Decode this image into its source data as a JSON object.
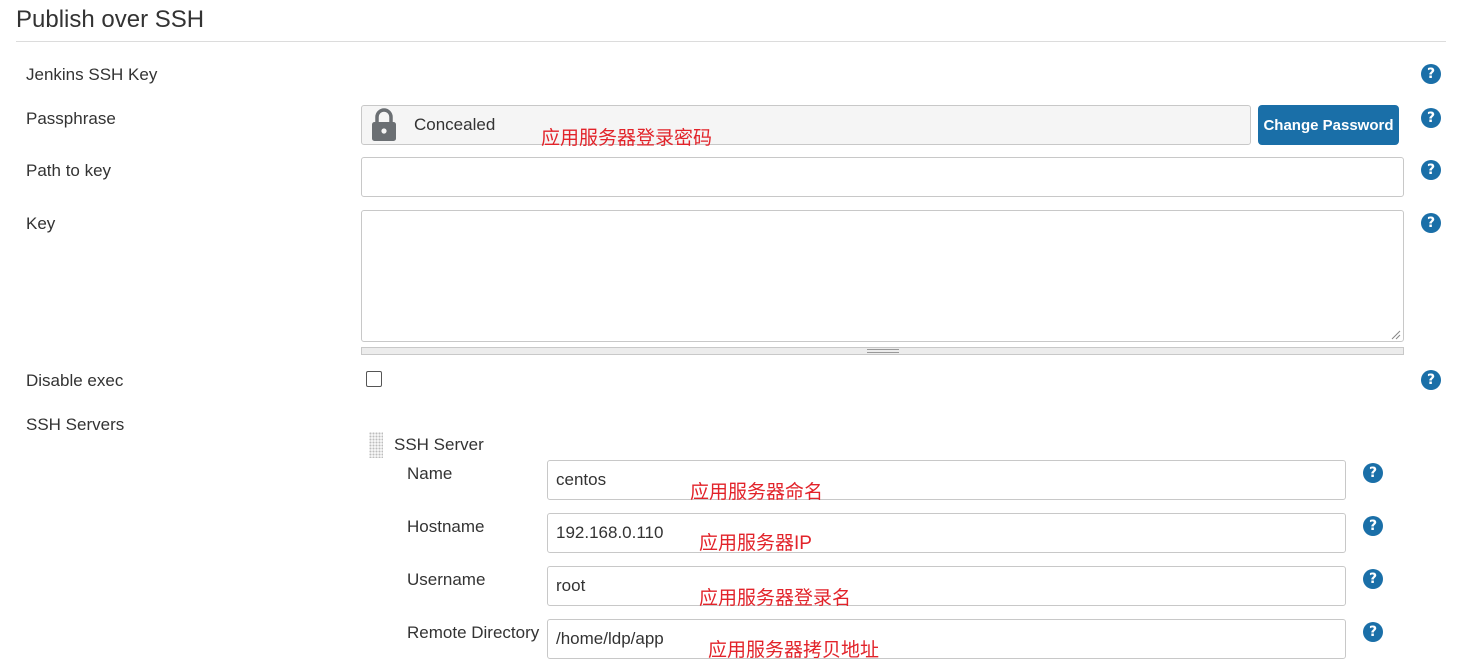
{
  "section": {
    "title": "Publish over SSH"
  },
  "fields": {
    "jenkins_ssh_key": {
      "label": "Jenkins SSH Key"
    },
    "passphrase": {
      "label": "Passphrase",
      "status": "Concealed",
      "change_button": "Change Password",
      "annotation": "应用服务器登录密码"
    },
    "path_to_key": {
      "label": "Path to key",
      "value": ""
    },
    "key": {
      "label": "Key",
      "value": ""
    },
    "disable_exec": {
      "label": "Disable exec",
      "checked": false
    }
  },
  "ssh_servers": {
    "label": "SSH Servers",
    "server": {
      "title": "SSH Server",
      "name": {
        "label": "Name",
        "value": "centos",
        "annotation": "应用服务器命名"
      },
      "hostname": {
        "label": "Hostname",
        "value": "192.168.0.110",
        "annotation": "应用服务器IP"
      },
      "username": {
        "label": "Username",
        "value": "root",
        "annotation": "应用服务器登录名"
      },
      "remote_directory": {
        "label": "Remote Directory",
        "value": "/home/ldp/app",
        "annotation": "应用服务器拷贝地址"
      }
    }
  },
  "help": {
    "glyph": "?"
  },
  "colors": {
    "accent": "#1a6fa8",
    "annotation": "#e2232a"
  }
}
